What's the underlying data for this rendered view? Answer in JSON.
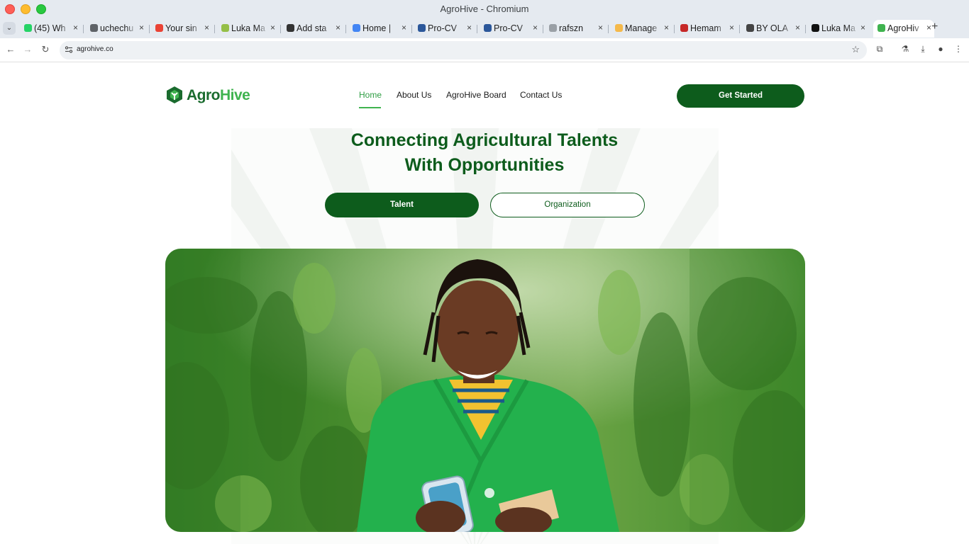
{
  "window": {
    "title": "AgroHive - Chromium"
  },
  "tabs": [
    {
      "label": "(45) Wh",
      "icon": "whatsapp-icon",
      "color": "#25d366"
    },
    {
      "label": "uchechu",
      "icon": "globe-icon",
      "color": "#5f6368"
    },
    {
      "label": "Your sin",
      "icon": "gmail-icon",
      "color": "#ea4335"
    },
    {
      "label": "Luka Ma",
      "icon": "shopify-icon",
      "color": "#95bf47"
    },
    {
      "label": "Add sta",
      "icon": "github-icon",
      "color": "#333333"
    },
    {
      "label": "Home |",
      "icon": "google-icon",
      "color": "#4285f4"
    },
    {
      "label": "Pro-CV",
      "icon": "word-icon",
      "color": "#2b579a"
    },
    {
      "label": "Pro-CV",
      "icon": "word-icon",
      "color": "#2b579a"
    },
    {
      "label": "rafszn",
      "icon": "dot-icon",
      "color": "#9aa0a6"
    },
    {
      "label": "Manage",
      "icon": "hand-icon",
      "color": "#f5b94a"
    },
    {
      "label": "Hemam",
      "icon": "hemam-icon",
      "color": "#c62828"
    },
    {
      "label": "BY OLA",
      "icon": "ola-icon",
      "color": "#444444"
    },
    {
      "label": "Luka Ma",
      "icon": "luka-icon",
      "color": "#111111"
    },
    {
      "label": "AgroHiv",
      "icon": "agrohive-icon",
      "color": "#3fb34f",
      "active": true
    }
  ],
  "toolbar": {
    "url": "agrohive.co"
  },
  "site": {
    "logo": {
      "agro": "Agro",
      "hive": "Hive"
    },
    "nav": [
      {
        "label": "Home",
        "active": true
      },
      {
        "label": "About Us"
      },
      {
        "label": "AgroHive Board"
      },
      {
        "label": "Contact Us"
      }
    ],
    "cta": "Get Started",
    "hero": {
      "title_line1": "Connecting Agricultural Talents",
      "title_line2": "With Opportunities",
      "talent_button": "Talent",
      "organization_button": "Organization"
    }
  },
  "colors": {
    "brand_dark": "#0d5c1c",
    "brand_light": "#3fb34f",
    "jacket": "#23b14d"
  }
}
